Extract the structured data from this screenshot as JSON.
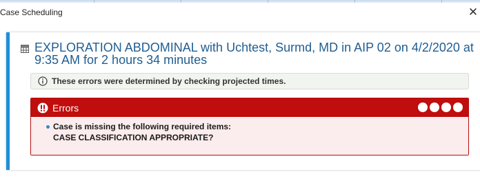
{
  "window": {
    "title": "Case Scheduling",
    "close_glyph": "✕"
  },
  "case": {
    "heading_line1": "EXPLORATION ABDOMINAL with Uchtest, Surmd, MD in AIP 02 on 4/2/2020 at",
    "heading_line2": "9:35 AM for 2 hours 34 minutes",
    "icon": "calendar-grid-icon"
  },
  "info": {
    "icon": "info-icon",
    "text": "These errors were determined by checking projected times."
  },
  "errors": {
    "icon": "error-exclamation-icon",
    "title": "Errors",
    "indicator_count": 4,
    "items": [
      {
        "line1": "Case is missing the following required items:",
        "line2": "CASE CLASSIFICATION APPROPRIATE?"
      }
    ]
  },
  "colors": {
    "accent_blue": "#1e8fd8",
    "heading_blue": "#1f5d91",
    "error_red": "#c00d0d",
    "error_bg": "#fbeced",
    "info_bg": "#f1f4ef"
  }
}
